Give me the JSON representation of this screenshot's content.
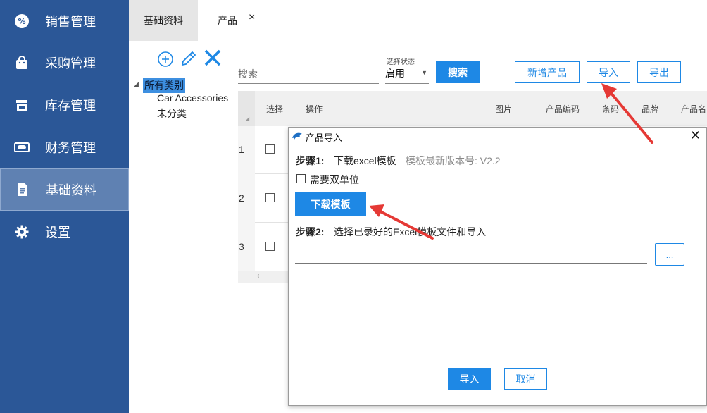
{
  "sidebar": {
    "items": [
      {
        "label": "销售管理",
        "icon": "sales-badge-icon"
      },
      {
        "label": "采购管理",
        "icon": "shopping-bag-icon"
      },
      {
        "label": "库存管理",
        "icon": "store-icon"
      },
      {
        "label": "财务管理",
        "icon": "money-icon"
      },
      {
        "label": "基础资料",
        "icon": "document-icon",
        "active": true
      },
      {
        "label": "设置",
        "icon": "gear-icon"
      }
    ],
    "bg_color": "#2b5797",
    "active_color": "#5f81b2"
  },
  "tabs": [
    {
      "label": "基础资料"
    },
    {
      "label": "产品",
      "active": true,
      "close": "×"
    }
  ],
  "tree": {
    "root": "所有类别",
    "nodes": [
      "Car Accessories",
      "未分类"
    ]
  },
  "toolbar": {
    "search_placeholder": "搜索",
    "status_label": "选择状态",
    "status_value": "启用",
    "search_button": "搜索",
    "add_button": "新增产品",
    "import_button": "导入",
    "export_button": "导出"
  },
  "table": {
    "columns": [
      "选择",
      "操作",
      "图片",
      "产品编码",
      "条码",
      "品牌",
      "产品名"
    ],
    "row_numbers": [
      "1",
      "2",
      "3"
    ],
    "scroll_arrow": "‹"
  },
  "dialog": {
    "title": "产品导入",
    "step1_label": "步骤1:",
    "step1_text": "下载excel模板",
    "step1_hint": "模板最新版本号: V2.2",
    "dual_unit_label": "需要双单位",
    "download_button": "下载模板",
    "step2_label": "步骤2:",
    "step2_text": "选择已录好的Excel模板文件和导入",
    "browse_button": "...",
    "import_button": "导入",
    "cancel_button": "取消"
  },
  "colors": {
    "accent": "#1e88e5",
    "annotation_arrow": "#e53935"
  }
}
